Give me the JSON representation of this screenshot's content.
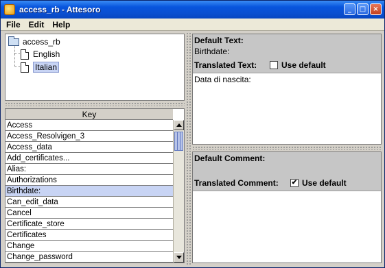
{
  "window": {
    "title": "access_rb - Attesoro",
    "minimize": "_",
    "maximize": "□",
    "close": "×"
  },
  "menu": {
    "file": "File",
    "edit": "Edit",
    "help": "Help"
  },
  "tree": {
    "root": "access_rb",
    "children": [
      "English",
      "Italian"
    ],
    "selected": "Italian"
  },
  "table": {
    "header": "Key",
    "rows": [
      "Access",
      "Access_Resolvigen_3",
      "Access_data",
      "Add_certificates...",
      "Alias:",
      "Authorizations",
      "Birthdate:",
      "Can_edit_data",
      "Cancel",
      "Certificate_store",
      "Certificates",
      "Change",
      "Change_password"
    ],
    "selected_index": 6
  },
  "editor": {
    "default_text_label": "Default Text:",
    "default_text_value": "Birthdate:",
    "translated_text_label": "Translated Text:",
    "translated_use_default_label": "Use default",
    "translated_use_default_checked": false,
    "translated_text_value": "Data di nascita:",
    "default_comment_label": "Default Comment:",
    "translated_comment_label": "Translated Comment:",
    "comment_use_default_label": "Use default",
    "comment_use_default_checked": true
  },
  "icons": {
    "app": "app-icon",
    "folder": "folder-icon",
    "document": "document-icon"
  }
}
